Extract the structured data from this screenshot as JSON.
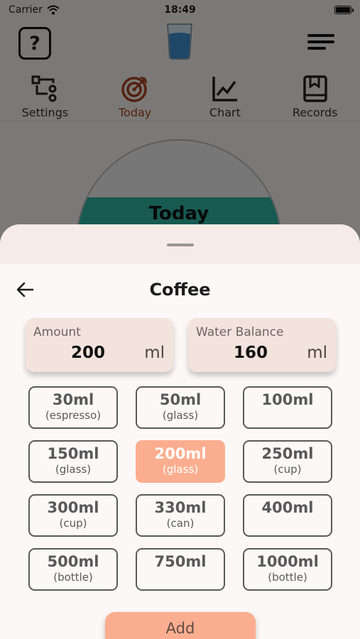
{
  "status_bar": {
    "carrier": "Carrier",
    "time": "18:49"
  },
  "header": {
    "help_label": "?"
  },
  "tabs": [
    {
      "label": "Settings",
      "icon": "settings-icon"
    },
    {
      "label": "Today",
      "icon": "target-icon",
      "active": true
    },
    {
      "label": "Chart",
      "icon": "chart-icon"
    },
    {
      "label": "Records",
      "icon": "records-icon"
    }
  ],
  "today_circle": {
    "label": "Today"
  },
  "sheet": {
    "title": "Coffee",
    "amount": {
      "label": "Amount",
      "value": "200",
      "unit": "ml"
    },
    "water_balance": {
      "label": "Water Balance",
      "value": "160",
      "unit": "ml"
    },
    "options": [
      {
        "amount": "30ml",
        "sub": "(espresso)"
      },
      {
        "amount": "50ml",
        "sub": "(glass)"
      },
      {
        "amount": "100ml",
        "sub": ""
      },
      {
        "amount": "150ml",
        "sub": "(glass)"
      },
      {
        "amount": "200ml",
        "sub": "(glass)",
        "selected": true
      },
      {
        "amount": "250ml",
        "sub": "(cup)"
      },
      {
        "amount": "300ml",
        "sub": "(cup)"
      },
      {
        "amount": "330ml",
        "sub": "(can)"
      },
      {
        "amount": "400ml",
        "sub": ""
      },
      {
        "amount": "500ml",
        "sub": "(bottle)"
      },
      {
        "amount": "750ml",
        "sub": ""
      },
      {
        "amount": "1000ml",
        "sub": "(bottle)"
      }
    ],
    "add_label": "Add"
  },
  "colors": {
    "accent": "#fbae8f",
    "active_tab": "#a8411e",
    "water": "#2eb4a2",
    "card_bg": "#f3e3dd"
  }
}
